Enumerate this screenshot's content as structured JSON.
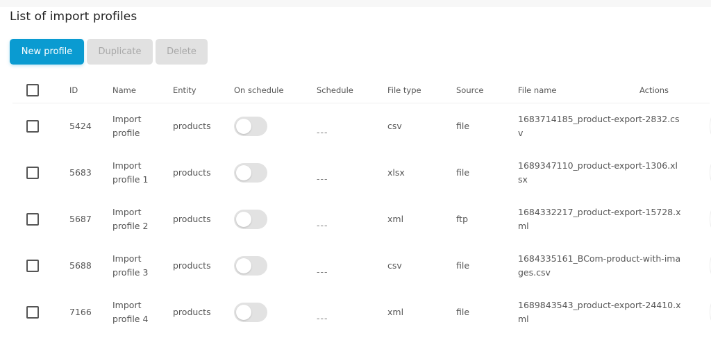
{
  "page": {
    "title": "List of import profiles"
  },
  "toolbar": {
    "new_label": "New profile",
    "duplicate_label": "Duplicate",
    "delete_label": "Delete"
  },
  "table": {
    "columns": [
      "ID",
      "Name",
      "Entity",
      "On schedule",
      "Schedule",
      "File type",
      "Source",
      "File name",
      "Actions"
    ],
    "rows": [
      {
        "id": "5424",
        "name": "Import profile",
        "entity": "products",
        "on_schedule": false,
        "schedule": "---",
        "file_type": "csv",
        "source": "file",
        "file_name": "1683714185_product-export-2832.csv"
      },
      {
        "id": "5683",
        "name": "Import profile 1",
        "entity": "products",
        "on_schedule": false,
        "schedule": "---",
        "file_type": "xlsx",
        "source": "file",
        "file_name": "1689347110_product-export-1306.xlsx"
      },
      {
        "id": "5687",
        "name": "Import profile 2",
        "entity": "products",
        "on_schedule": false,
        "schedule": "---",
        "file_type": "xml",
        "source": "ftp",
        "file_name": "1684332217_product-export-15728.xml"
      },
      {
        "id": "5688",
        "name": "Import profile 3",
        "entity": "products",
        "on_schedule": false,
        "schedule": "---",
        "file_type": "csv",
        "source": "file",
        "file_name": "1684335161_BCom-product-with-images.csv"
      },
      {
        "id": "7166",
        "name": "Import profile 4",
        "entity": "products",
        "on_schedule": false,
        "schedule": "---",
        "file_type": "xml",
        "source": "file",
        "file_name": "1689843543_product-export-24410.xml"
      }
    ],
    "row_actions": [
      {
        "icon": "play-icon"
      },
      {
        "icon": "trash-icon"
      }
    ]
  },
  "colors": {
    "primary": "#0a9bd1",
    "disabled_bg": "#e1e1e1",
    "disabled_text": "#a8a8a8",
    "toggle_off": "#e2e2e2"
  }
}
